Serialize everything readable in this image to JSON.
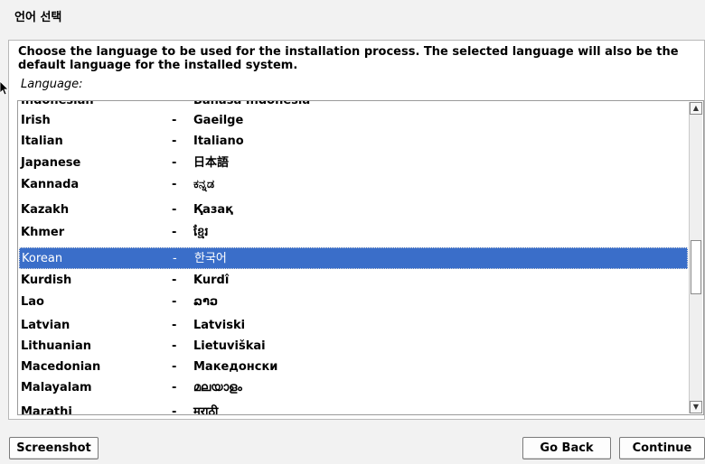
{
  "window": {
    "title": "언어 선택"
  },
  "description": "Choose the language to be used for the installation process. The selected language will also be the default language for the installed system.",
  "language_label": "Language:",
  "languages": [
    {
      "name": "Indonesian",
      "separator": "-",
      "native": "Bahasa Indonesia"
    },
    {
      "name": "Irish",
      "separator": "-",
      "native": "Gaeilge"
    },
    {
      "name": "Italian",
      "separator": "-",
      "native": "Italiano"
    },
    {
      "name": "Japanese",
      "separator": "-",
      "native": "日本語"
    },
    {
      "name": "Kannada",
      "separator": "-",
      "native": "ಕನ್ನಡ"
    },
    {
      "name": "Kazakh",
      "separator": "-",
      "native": "Қазақ"
    },
    {
      "name": "Khmer",
      "separator": "-",
      "native": "ខ្មែរ"
    },
    {
      "name": "Korean",
      "separator": "-",
      "native": "한국어",
      "selected": true
    },
    {
      "name": "Kurdish",
      "separator": "-",
      "native": "Kurdî"
    },
    {
      "name": "Lao",
      "separator": "-",
      "native": "ລາວ"
    },
    {
      "name": "Latvian",
      "separator": "-",
      "native": "Latviski"
    },
    {
      "name": "Lithuanian",
      "separator": "-",
      "native": "Lietuviškai"
    },
    {
      "name": "Macedonian",
      "separator": "-",
      "native": "Македонски"
    },
    {
      "name": "Malayalam",
      "separator": "-",
      "native": "മലയാളം"
    },
    {
      "name": "Marathi",
      "separator": "-",
      "native": "मराठी"
    }
  ],
  "buttons": {
    "screenshot": "Screenshot",
    "go_back": "Go Back",
    "continue": "Continue"
  },
  "icons": {
    "scroll_up": "scroll-up-arrow-icon",
    "scroll_down": "scroll-down-arrow-icon",
    "cursor": "mouse-pointer-icon"
  },
  "colors": {
    "selection": "#3a6ec9",
    "background": "#f2f2f2"
  }
}
